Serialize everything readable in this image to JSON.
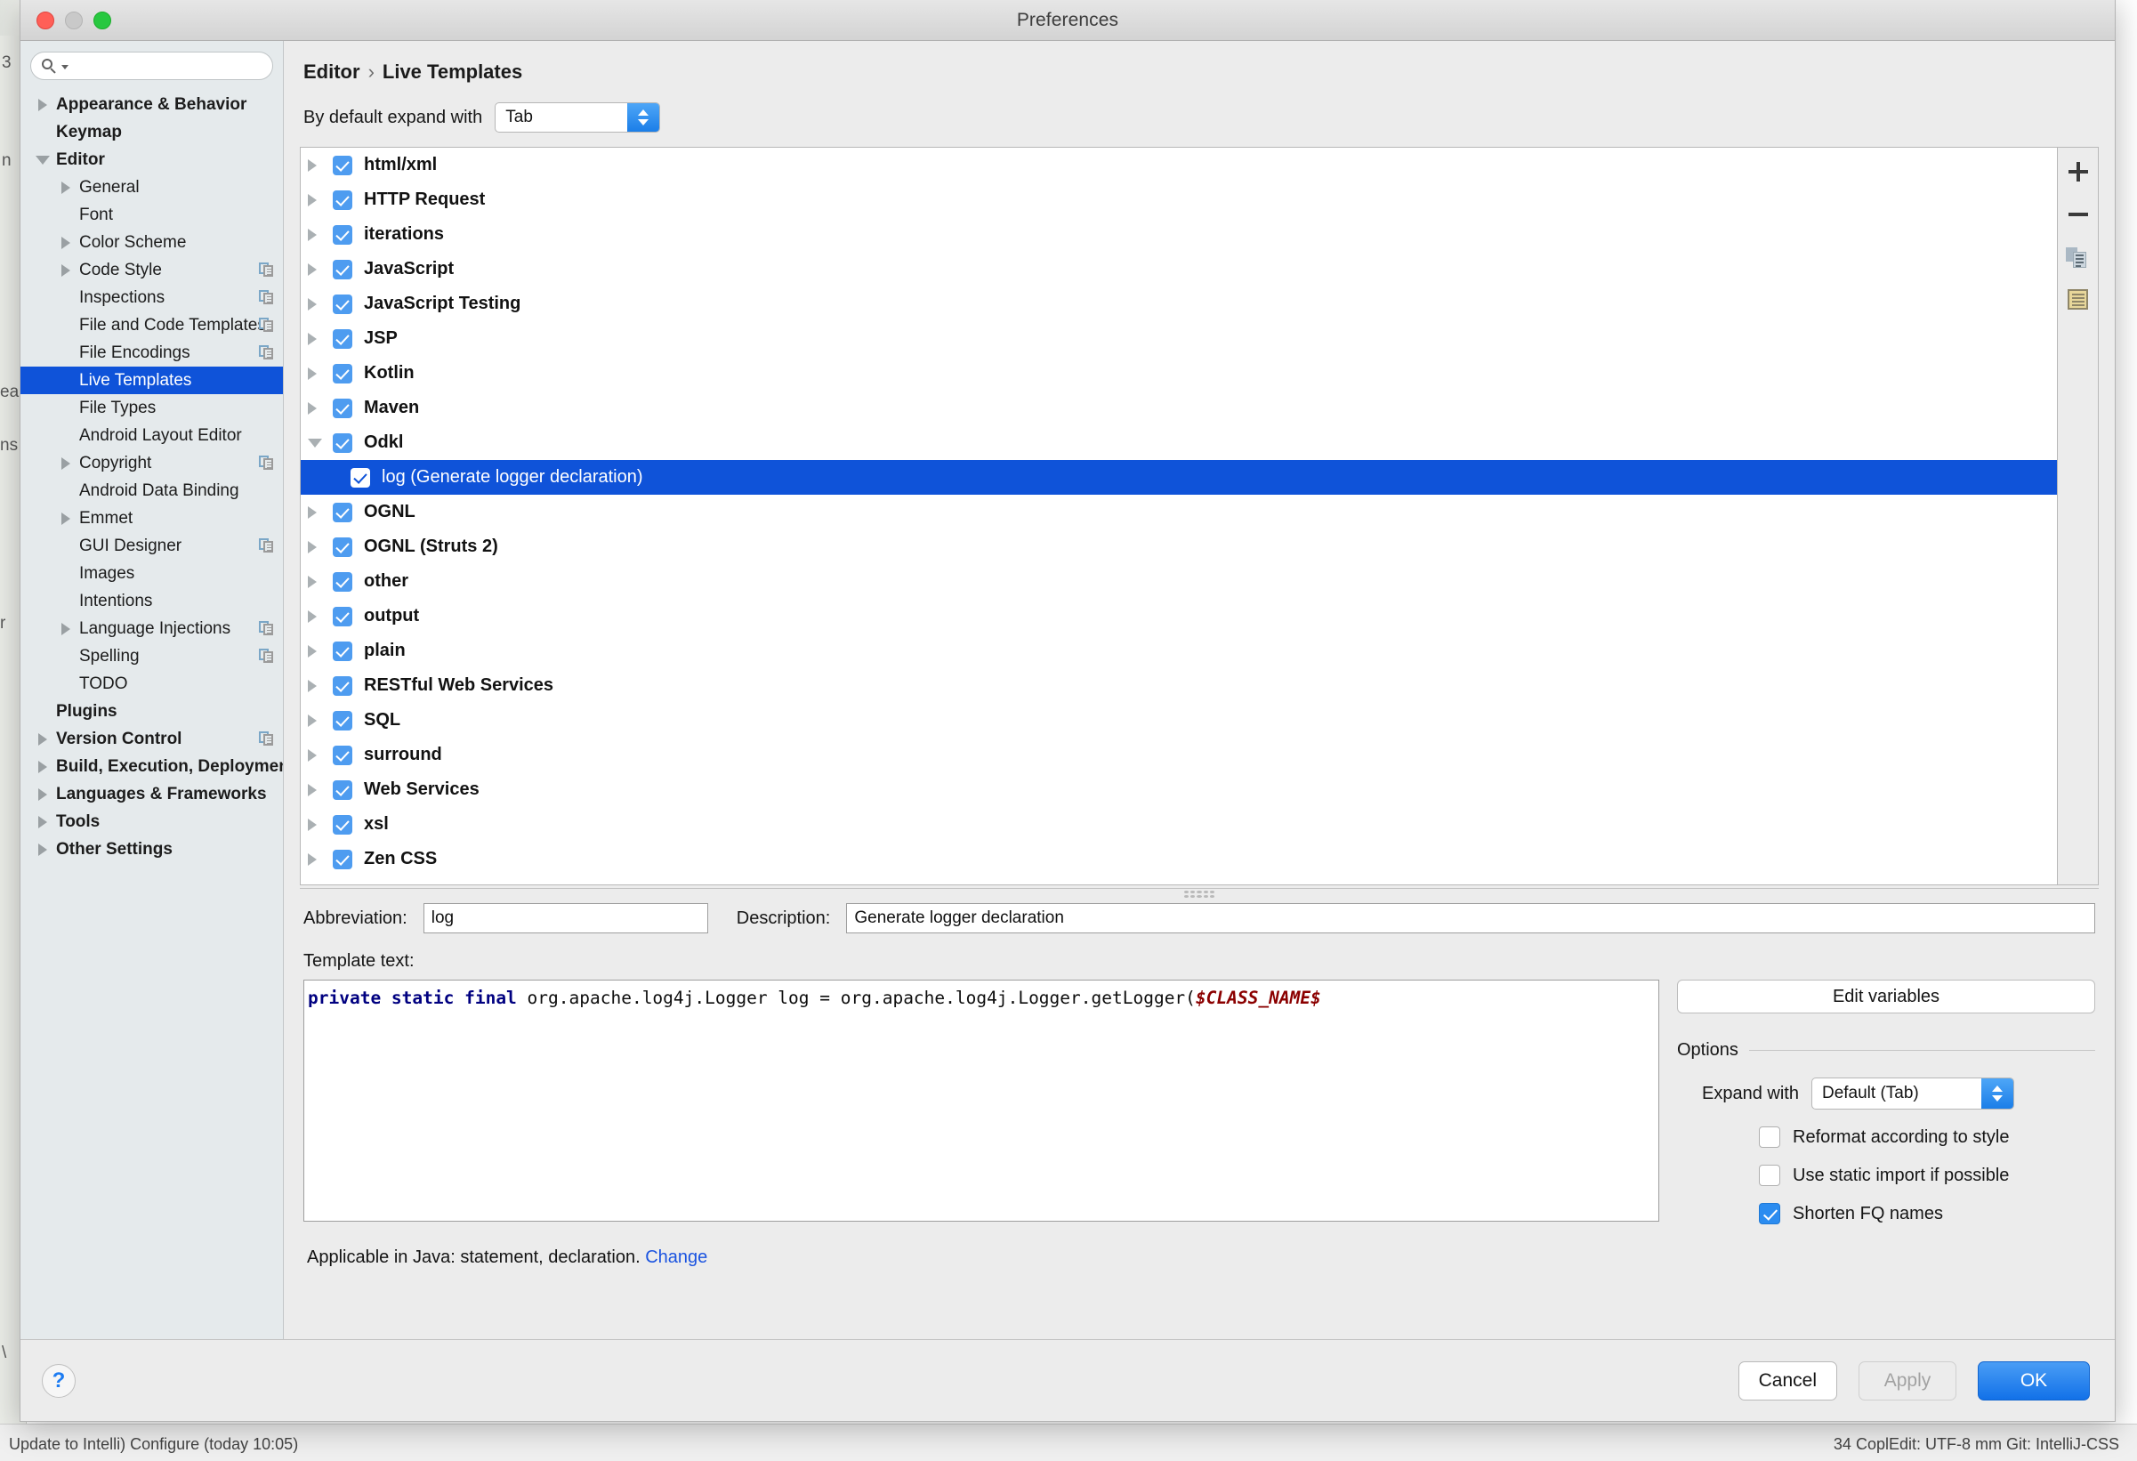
{
  "window": {
    "title": "Preferences",
    "traffic_lights": [
      "close-button",
      "minimize-button",
      "zoom-button"
    ]
  },
  "search": {
    "value": "",
    "placeholder": ""
  },
  "sidebar": {
    "items": [
      {
        "label": "Appearance & Behavior",
        "indent": 0,
        "arrow": "right",
        "bold": true,
        "badge": false,
        "selected": false
      },
      {
        "label": "Keymap",
        "indent": 0,
        "arrow": "none",
        "bold": true,
        "badge": false,
        "selected": false
      },
      {
        "label": "Editor",
        "indent": 0,
        "arrow": "down",
        "bold": true,
        "badge": false,
        "selected": false
      },
      {
        "label": "General",
        "indent": 1,
        "arrow": "right",
        "bold": false,
        "badge": false,
        "selected": false
      },
      {
        "label": "Font",
        "indent": 1,
        "arrow": "none",
        "bold": false,
        "badge": false,
        "selected": false
      },
      {
        "label": "Color Scheme",
        "indent": 1,
        "arrow": "right",
        "bold": false,
        "badge": false,
        "selected": false
      },
      {
        "label": "Code Style",
        "indent": 1,
        "arrow": "right",
        "bold": false,
        "badge": true,
        "selected": false
      },
      {
        "label": "Inspections",
        "indent": 1,
        "arrow": "none",
        "bold": false,
        "badge": true,
        "selected": false
      },
      {
        "label": "File and Code Templates",
        "indent": 1,
        "arrow": "none",
        "bold": false,
        "badge": true,
        "selected": false
      },
      {
        "label": "File Encodings",
        "indent": 1,
        "arrow": "none",
        "bold": false,
        "badge": true,
        "selected": false
      },
      {
        "label": "Live Templates",
        "indent": 1,
        "arrow": "none",
        "bold": false,
        "badge": false,
        "selected": true
      },
      {
        "label": "File Types",
        "indent": 1,
        "arrow": "none",
        "bold": false,
        "badge": false,
        "selected": false
      },
      {
        "label": "Android Layout Editor",
        "indent": 1,
        "arrow": "none",
        "bold": false,
        "badge": false,
        "selected": false
      },
      {
        "label": "Copyright",
        "indent": 1,
        "arrow": "right",
        "bold": false,
        "badge": true,
        "selected": false
      },
      {
        "label": "Android Data Binding",
        "indent": 1,
        "arrow": "none",
        "bold": false,
        "badge": false,
        "selected": false
      },
      {
        "label": "Emmet",
        "indent": 1,
        "arrow": "right",
        "bold": false,
        "badge": false,
        "selected": false
      },
      {
        "label": "GUI Designer",
        "indent": 1,
        "arrow": "none",
        "bold": false,
        "badge": true,
        "selected": false
      },
      {
        "label": "Images",
        "indent": 1,
        "arrow": "none",
        "bold": false,
        "badge": false,
        "selected": false
      },
      {
        "label": "Intentions",
        "indent": 1,
        "arrow": "none",
        "bold": false,
        "badge": false,
        "selected": false
      },
      {
        "label": "Language Injections",
        "indent": 1,
        "arrow": "right",
        "bold": false,
        "badge": true,
        "selected": false
      },
      {
        "label": "Spelling",
        "indent": 1,
        "arrow": "none",
        "bold": false,
        "badge": true,
        "selected": false
      },
      {
        "label": "TODO",
        "indent": 1,
        "arrow": "none",
        "bold": false,
        "badge": false,
        "selected": false
      },
      {
        "label": "Plugins",
        "indent": 0,
        "arrow": "none",
        "bold": true,
        "badge": false,
        "selected": false
      },
      {
        "label": "Version Control",
        "indent": 0,
        "arrow": "right",
        "bold": true,
        "badge": true,
        "selected": false
      },
      {
        "label": "Build, Execution, Deployment",
        "indent": 0,
        "arrow": "right",
        "bold": true,
        "badge": false,
        "selected": false
      },
      {
        "label": "Languages & Frameworks",
        "indent": 0,
        "arrow": "right",
        "bold": true,
        "badge": false,
        "selected": false
      },
      {
        "label": "Tools",
        "indent": 0,
        "arrow": "right",
        "bold": true,
        "badge": false,
        "selected": false
      },
      {
        "label": "Other Settings",
        "indent": 0,
        "arrow": "right",
        "bold": true,
        "badge": false,
        "selected": false
      }
    ]
  },
  "breadcrumb": {
    "parent": "Editor",
    "separator": "›",
    "current": "Live Templates"
  },
  "expand_with": {
    "label": "By default expand with",
    "value": "Tab"
  },
  "template_list": {
    "rows": [
      {
        "label": "html/xml",
        "type": "group",
        "checked": true,
        "expanded": false,
        "selected": false
      },
      {
        "label": "HTTP Request",
        "type": "group",
        "checked": true,
        "expanded": false,
        "selected": false
      },
      {
        "label": "iterations",
        "type": "group",
        "checked": true,
        "expanded": false,
        "selected": false
      },
      {
        "label": "JavaScript",
        "type": "group",
        "checked": true,
        "expanded": false,
        "selected": false
      },
      {
        "label": "JavaScript Testing",
        "type": "group",
        "checked": true,
        "expanded": false,
        "selected": false
      },
      {
        "label": "JSP",
        "type": "group",
        "checked": true,
        "expanded": false,
        "selected": false
      },
      {
        "label": "Kotlin",
        "type": "group",
        "checked": true,
        "expanded": false,
        "selected": false
      },
      {
        "label": "Maven",
        "type": "group",
        "checked": true,
        "expanded": false,
        "selected": false
      },
      {
        "label": "Odkl",
        "type": "group",
        "checked": true,
        "expanded": true,
        "selected": false
      },
      {
        "label": "log (Generate logger declaration)",
        "type": "child",
        "checked": true,
        "expanded": false,
        "selected": true
      },
      {
        "label": "OGNL",
        "type": "group",
        "checked": true,
        "expanded": false,
        "selected": false
      },
      {
        "label": "OGNL (Struts 2)",
        "type": "group",
        "checked": true,
        "expanded": false,
        "selected": false
      },
      {
        "label": "other",
        "type": "group",
        "checked": true,
        "expanded": false,
        "selected": false
      },
      {
        "label": "output",
        "type": "group",
        "checked": true,
        "expanded": false,
        "selected": false
      },
      {
        "label": "plain",
        "type": "group",
        "checked": true,
        "expanded": false,
        "selected": false
      },
      {
        "label": "RESTful Web Services",
        "type": "group",
        "checked": true,
        "expanded": false,
        "selected": false
      },
      {
        "label": "SQL",
        "type": "group",
        "checked": true,
        "expanded": false,
        "selected": false
      },
      {
        "label": "surround",
        "type": "group",
        "checked": true,
        "expanded": false,
        "selected": false
      },
      {
        "label": "Web Services",
        "type": "group",
        "checked": true,
        "expanded": false,
        "selected": false
      },
      {
        "label": "xsl",
        "type": "group",
        "checked": true,
        "expanded": false,
        "selected": false
      },
      {
        "label": "Zen CSS",
        "type": "group",
        "checked": true,
        "expanded": false,
        "selected": false
      }
    ],
    "toolbar": [
      {
        "name": "add-template-button",
        "glyph": "plus"
      },
      {
        "name": "remove-template-button",
        "glyph": "minus"
      },
      {
        "name": "duplicate-template-button",
        "glyph": "copy"
      },
      {
        "name": "template-group-button",
        "glyph": "note"
      }
    ]
  },
  "detail": {
    "abbreviation_label": "Abbreviation:",
    "abbreviation_value": "log",
    "description_label": "Description:",
    "description_value": "Generate logger declaration",
    "template_text_label": "Template text:",
    "template_text": {
      "keywords": "private static final",
      "body": " org.apache.log4j.Logger log = org.apache.log4j.Logger.getLogger(",
      "variable": "$CLASS_NAME$"
    },
    "applicable_text": "Applicable in Java: statement, declaration.",
    "applicable_link": "Change"
  },
  "options": {
    "edit_variables_label": "Edit variables",
    "legend": "Options",
    "expand_with_label": "Expand with",
    "expand_with_value": "Default (Tab)",
    "checkboxes": [
      {
        "label": "Reformat according to style",
        "checked": false
      },
      {
        "label": "Use static import if possible",
        "checked": false
      },
      {
        "label": "Shorten FQ names",
        "checked": true
      }
    ]
  },
  "footer": {
    "help_glyph": "?",
    "cancel_label": "Cancel",
    "apply_label": "Apply",
    "ok_label": "OK"
  },
  "background": {
    "bottom_left_text": "Update to Intelli) Configure (today 10:05)",
    "bottom_right_text": "34  CoplEdit: UTF-8  mm  Git: IntelliJ-CSS"
  },
  "colors": {
    "accent_blue": "#0f53d9",
    "checkbox_blue": "#4e9cf0",
    "link_blue": "#1a53e0",
    "sidebar_bg": "#e5eaec",
    "panel_bg": "#ececec"
  }
}
